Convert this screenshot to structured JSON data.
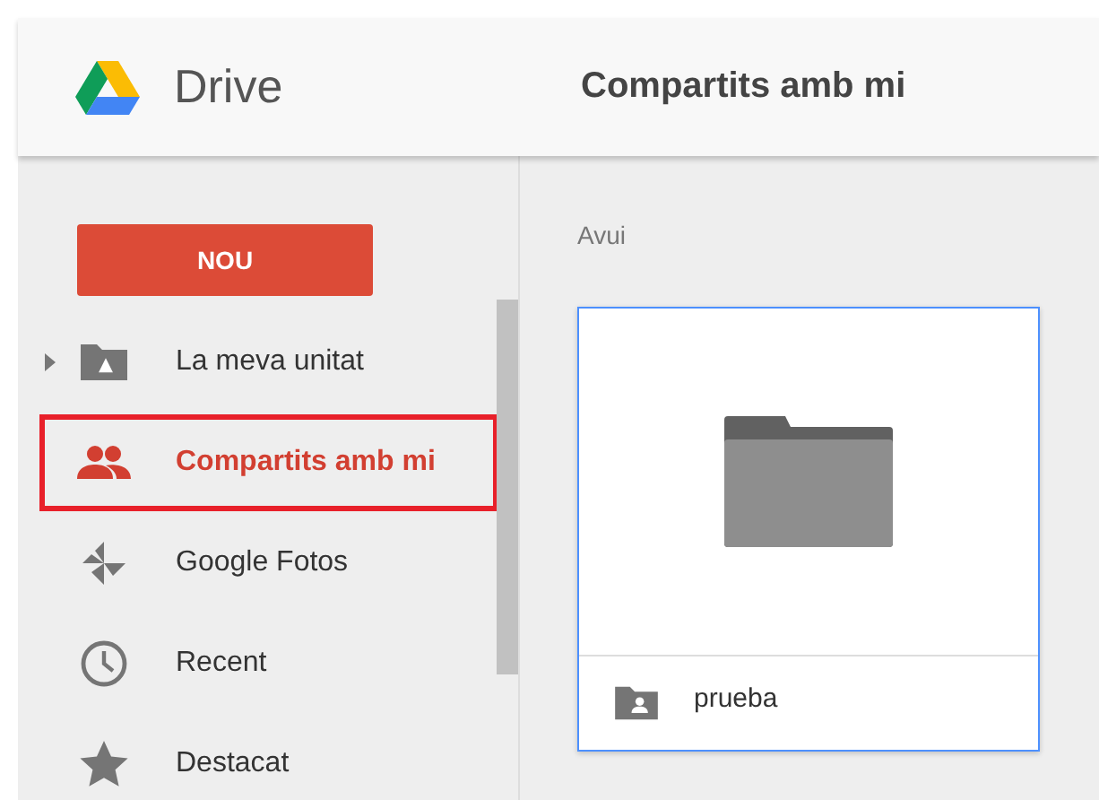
{
  "header": {
    "app_name": "Drive",
    "page_title": "Compartits amb mi"
  },
  "sidebar": {
    "new_button": "NOU",
    "items": [
      {
        "kind": "drive",
        "label": "La meva unitat",
        "selected": false,
        "expandable": true,
        "highlighted": false
      },
      {
        "kind": "shared",
        "label": "Compartits amb mi",
        "selected": true,
        "expandable": false,
        "highlighted": true
      },
      {
        "kind": "photos",
        "label": "Google Fotos",
        "selected": false,
        "expandable": false,
        "highlighted": false
      },
      {
        "kind": "recent",
        "label": "Recent",
        "selected": false,
        "expandable": false,
        "highlighted": false
      },
      {
        "kind": "starred",
        "label": "Destacat",
        "selected": false,
        "expandable": false,
        "highlighted": false
      }
    ]
  },
  "main": {
    "section_heading": "Avui",
    "files": [
      {
        "kind": "shared_folder",
        "name": "prueba",
        "selected": true
      }
    ]
  }
}
